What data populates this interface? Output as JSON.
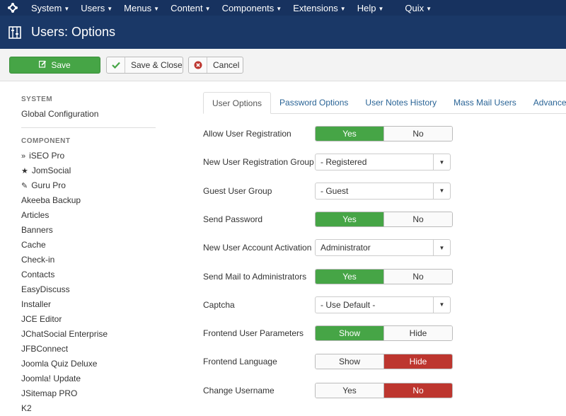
{
  "topnav": {
    "logo_icon": "joomla-logo-icon",
    "items": [
      {
        "label": "System"
      },
      {
        "label": "Users"
      },
      {
        "label": "Menus"
      },
      {
        "label": "Content"
      },
      {
        "label": "Components"
      },
      {
        "label": "Extensions"
      },
      {
        "label": "Help"
      },
      {
        "label": "Quix"
      }
    ]
  },
  "header": {
    "icon": "options-grid-icon",
    "title": "Users: Options"
  },
  "toolbar": {
    "save_label": "Save",
    "save_close_label": "Save & Close",
    "cancel_label": "Cancel"
  },
  "sidebar": {
    "system_heading": "SYSTEM",
    "global_config": "Global Configuration",
    "component_heading": "COMPONENT",
    "items": [
      {
        "label": "iSEO Pro",
        "icon": "double-chevron-icon",
        "glyph": "»"
      },
      {
        "label": "JomSocial",
        "icon": "star-icon",
        "glyph": "★"
      },
      {
        "label": "Guru Pro",
        "icon": "pencil-icon",
        "glyph": "✎"
      },
      {
        "label": "Akeeba Backup"
      },
      {
        "label": "Articles"
      },
      {
        "label": "Banners"
      },
      {
        "label": "Cache"
      },
      {
        "label": "Check-in"
      },
      {
        "label": "Contacts"
      },
      {
        "label": "EasyDiscuss"
      },
      {
        "label": "Installer"
      },
      {
        "label": "JCE Editor"
      },
      {
        "label": "JChatSocial Enterprise"
      },
      {
        "label": "JFBConnect"
      },
      {
        "label": "Joomla Quiz Deluxe"
      },
      {
        "label": "Joomla! Update"
      },
      {
        "label": "JSitemap PRO"
      },
      {
        "label": "K2"
      }
    ]
  },
  "tabs": [
    {
      "label": "User Options",
      "active": true
    },
    {
      "label": "Password Options"
    },
    {
      "label": "User Notes History"
    },
    {
      "label": "Mass Mail Users"
    },
    {
      "label": "Advanced"
    }
  ],
  "form": {
    "rows": [
      {
        "label": "Allow User Registration",
        "type": "toggle",
        "options": [
          "Yes",
          "No"
        ],
        "selected": 0,
        "color": "green"
      },
      {
        "label": "New User Registration Group",
        "type": "select",
        "value": "- Registered"
      },
      {
        "label": "Guest User Group",
        "type": "select",
        "value": "- Guest"
      },
      {
        "label": "Send Password",
        "type": "toggle",
        "options": [
          "Yes",
          "No"
        ],
        "selected": 0,
        "color": "green"
      },
      {
        "label": "New User Account Activation",
        "type": "select",
        "value": "Administrator"
      },
      {
        "label": "Send Mail to Administrators",
        "type": "toggle",
        "options": [
          "Yes",
          "No"
        ],
        "selected": 0,
        "color": "green"
      },
      {
        "label": "Captcha",
        "type": "select",
        "value": "- Use Default -"
      },
      {
        "label": "Frontend User Parameters",
        "type": "toggle",
        "options": [
          "Show",
          "Hide"
        ],
        "selected": 0,
        "color": "green"
      },
      {
        "label": "Frontend Language",
        "type": "toggle",
        "options": [
          "Show",
          "Hide"
        ],
        "selected": 1,
        "color": "red"
      },
      {
        "label": "Change Username",
        "type": "toggle",
        "options": [
          "Yes",
          "No"
        ],
        "selected": 1,
        "color": "red"
      }
    ]
  },
  "colors": {
    "nav_bg": "#17325f",
    "header_bg": "#1a3867",
    "success": "#46a546",
    "danger": "#bd362f",
    "link": "#2a6496"
  }
}
